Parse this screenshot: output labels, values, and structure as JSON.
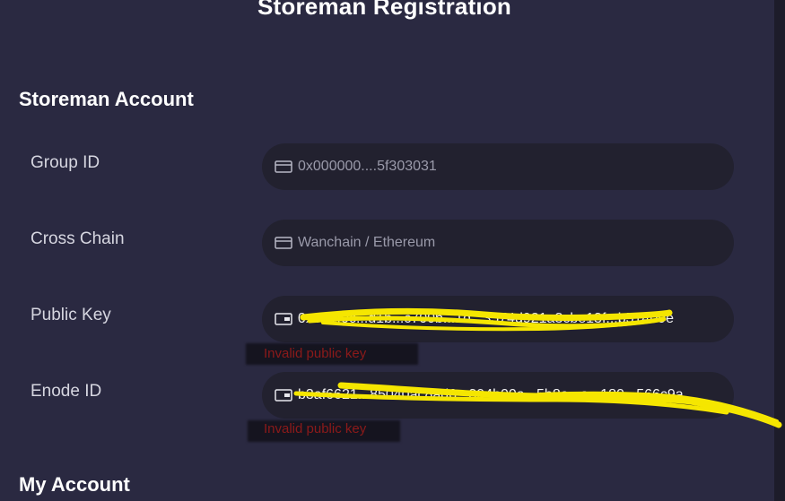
{
  "page": {
    "title": "Storeman Registration"
  },
  "storeman_account": {
    "heading": "Storeman Account",
    "group_id": {
      "label": "Group ID",
      "value": "0x000000....5f303031",
      "icon": "wallet-icon"
    },
    "cross_chain": {
      "label": "Cross Chain",
      "value": "Wanchain / Ethereum",
      "icon": "wallet-icon"
    },
    "public_key": {
      "label": "Public Key",
      "value": "0x641f0c...d1b...c700b...1d...3574d921a3cbe13f...b51409e",
      "icon": "wallet-icon",
      "error": "Invalid public key"
    },
    "enode_id": {
      "label": "Enode ID",
      "value": "b3af6621...85040ac8ad6...394b00a...5b8e...a...180...566c9a",
      "icon": "wallet-icon",
      "error": "Invalid public key"
    }
  },
  "my_account": {
    "heading": "My Account"
  },
  "colors": {
    "background": "#2a2941",
    "field": "#22212f",
    "error": "#8c1a1a",
    "highlight": "#f5e600"
  }
}
